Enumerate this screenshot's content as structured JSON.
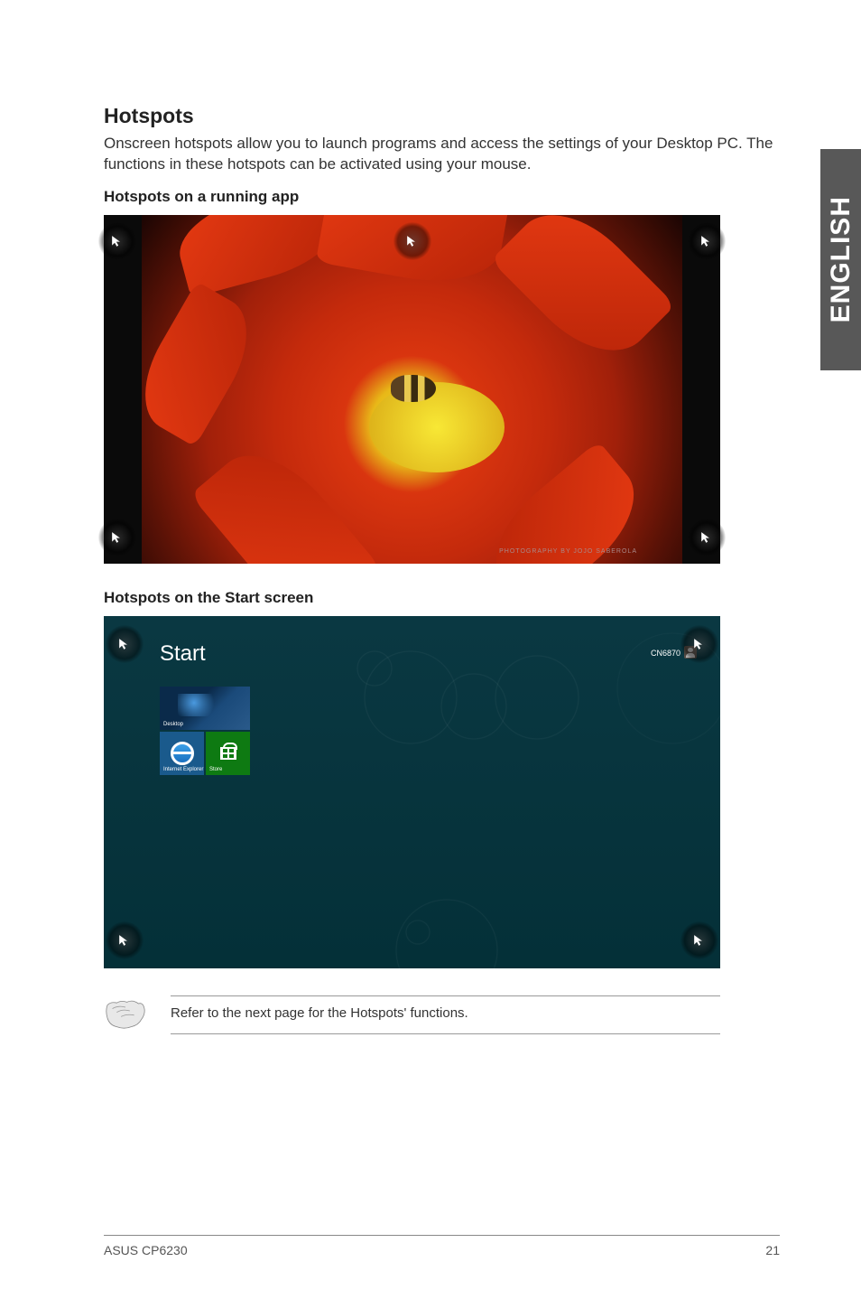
{
  "side_tab": "ENGLISH",
  "heading": "Hotspots",
  "intro": "Onscreen hotspots allow you to launch programs and access the settings of your Desktop PC. The functions in these hotspots can be activated using your mouse.",
  "sub1": "Hotspots on a running app",
  "screenshot1": {
    "caption": "PHOTOGRAPHY BY JOJO SABEROLA"
  },
  "sub2": "Hotspots on the Start screen",
  "screenshot2": {
    "start_label": "Start",
    "user_label": "CN6870",
    "tiles": {
      "desktop": "Desktop",
      "ie": "Internet Explorer",
      "store": "Store"
    }
  },
  "note": "Refer to the next page for the Hotspots' functions.",
  "footer": {
    "left": "ASUS CP6230",
    "right": "21"
  }
}
